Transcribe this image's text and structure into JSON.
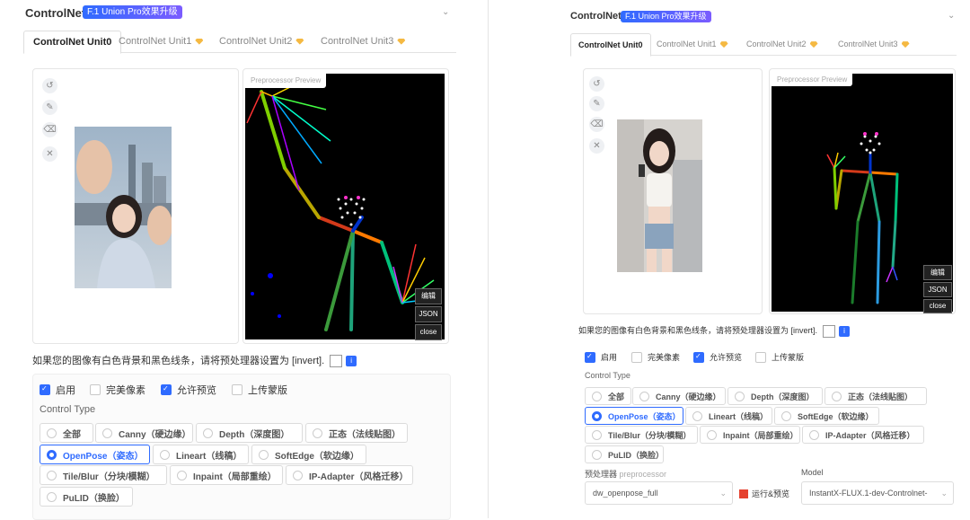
{
  "header": {
    "title": "ControlNet",
    "badge": "F.1 Union Pro效果升级"
  },
  "tabs": [
    {
      "label": "ControlNet Unit0",
      "gem": false
    },
    {
      "label": "ControlNet Unit1",
      "gem": true
    },
    {
      "label": "ControlNet Unit2",
      "gem": true
    },
    {
      "label": "ControlNet Unit3",
      "gem": true
    }
  ],
  "preview": {
    "label": "Preprocessor Preview",
    "overlay_buttons": [
      "编辑",
      "JSON",
      "close"
    ]
  },
  "hint": "如果您的图像有白色背景和黑色线条，请将预处理器设置为 [invert].",
  "checkboxes": [
    {
      "label": "启用",
      "checked": true
    },
    {
      "label": "完美像素",
      "checked": false
    },
    {
      "label": "允许预览",
      "checked": true
    },
    {
      "label": "上传蒙版",
      "checked": false
    }
  ],
  "control_type_label": "Control Type",
  "control_types": [
    {
      "label": "全部",
      "selected": false
    },
    {
      "label": "Canny（硬边缘）",
      "selected": false
    },
    {
      "label": "Depth（深度图）",
      "selected": false
    },
    {
      "label": "正态（法线贴图）",
      "selected": false
    },
    {
      "label": "OpenPose（姿态）",
      "selected": true
    },
    {
      "label": "Lineart（线稿）",
      "selected": false
    },
    {
      "label": "SoftEdge（软边缘）",
      "selected": false
    },
    {
      "label": "Tile/Blur（分块/模糊）",
      "selected": false
    },
    {
      "label": "Inpaint（局部重绘）",
      "selected": false
    },
    {
      "label": "IP-Adapter（风格迁移）",
      "selected": false
    },
    {
      "label": "PuLID（换脸）",
      "selected": false
    }
  ],
  "preprocessor": {
    "label": "预处理器",
    "label_sub": "preprocessor",
    "value": "dw_openpose_full",
    "run_label": "运行&预览"
  },
  "model": {
    "label": "Model",
    "value": "InstantX-FLUX.1-dev-Controlnet-"
  },
  "colors": {
    "accent": "#2f6bff",
    "check": "#2f6bff",
    "gem": "#f5b942",
    "run_icon": "#e5412e"
  },
  "icons": [
    "undo-icon",
    "pencil-icon",
    "eraser-icon",
    "close-icon",
    "note-icon",
    "info-icon",
    "gem-icon",
    "chevron-down-icon"
  ]
}
